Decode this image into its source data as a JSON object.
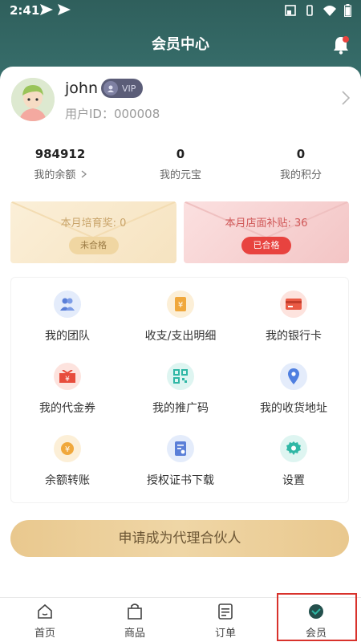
{
  "status_bar": {
    "time": "2:41"
  },
  "header": {
    "title": "会员中心",
    "accent": "#3e7b78"
  },
  "profile": {
    "username": "john",
    "vip": "VIP",
    "user_id": "用户ID：000008"
  },
  "stats": [
    {
      "value": "984912",
      "label": "我的余额"
    },
    {
      "value": "0",
      "label": "我的元宝"
    },
    {
      "value": "0",
      "label": "我的积分"
    }
  ],
  "awards": {
    "monthly_training": {
      "title": "本月培育奖: 0",
      "status": "未合格"
    },
    "store_subsidy": {
      "title": "本月店面补贴: 36",
      "status": "已合格"
    }
  },
  "menu": [
    {
      "label": "我的团队",
      "icon": "team-icon"
    },
    {
      "label": "收支/支出明细",
      "icon": "ledger-icon"
    },
    {
      "label": "我的银行卡",
      "icon": "bank-card-icon"
    },
    {
      "label": "我的代金券",
      "icon": "voucher-icon"
    },
    {
      "label": "我的推广码",
      "icon": "qr-code-icon"
    },
    {
      "label": "我的收货地址",
      "icon": "location-icon"
    },
    {
      "label": "余额转账",
      "icon": "yen-coin-icon"
    },
    {
      "label": "授权证书下载",
      "icon": "certificate-icon"
    },
    {
      "label": "设置",
      "icon": "gear-icon"
    }
  ],
  "apply_button": "申请成为代理合伙人",
  "tabs": [
    {
      "label": "首页",
      "icon": "home-icon"
    },
    {
      "label": "商品",
      "icon": "bag-icon"
    },
    {
      "label": "订单",
      "icon": "order-icon"
    },
    {
      "label": "会员",
      "icon": "member-icon",
      "active": true
    }
  ]
}
